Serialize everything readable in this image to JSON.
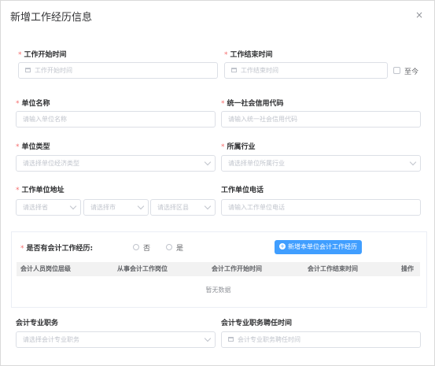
{
  "dialog": {
    "title": "新增工作经历信息",
    "close_icon": "×"
  },
  "form": {
    "start_time": {
      "label": "工作开始时间",
      "placeholder": "工作开始时间"
    },
    "end_time": {
      "label": "工作结束时间",
      "placeholder": "工作结束时间",
      "until_now_label": "至今"
    },
    "unit_name": {
      "label": "单位名称",
      "placeholder": "请输入单位名称"
    },
    "credit_code": {
      "label": "统一社会信用代码",
      "placeholder": "请输入统一社会信用代码"
    },
    "unit_type": {
      "label": "单位类型",
      "placeholder": "请选择单位经济类型"
    },
    "industry": {
      "label": "所属行业",
      "placeholder": "请选择单位所属行业"
    },
    "address": {
      "label": "工作单位地址",
      "province_placeholder": "请选择省",
      "city_placeholder": "请选择市",
      "district_placeholder": "请选择区县"
    },
    "phone": {
      "label": "工作单位电话",
      "placeholder": "请输入工作单位电话"
    },
    "accounting": {
      "label": "是否有会计工作经历:",
      "option_no": "否",
      "option_yes": "是",
      "add_button": "新增本单位会计工作经历",
      "table": {
        "columns": [
          "会计人员岗位层级",
          "从事会计工作岗位",
          "会计工作开始时间",
          "会计工作结束时间",
          "操作"
        ],
        "empty_text": "暂无数据"
      }
    },
    "prof_title": {
      "label": "会计专业职务",
      "placeholder": "请选择会计专业职务"
    },
    "prof_title_time": {
      "label": "会计专业职务聘任时间",
      "placeholder": "会计专业职务聘任时间"
    }
  },
  "colors": {
    "required": "#f56c6c",
    "primary": "#409eff",
    "border": "#dcdfe6"
  }
}
